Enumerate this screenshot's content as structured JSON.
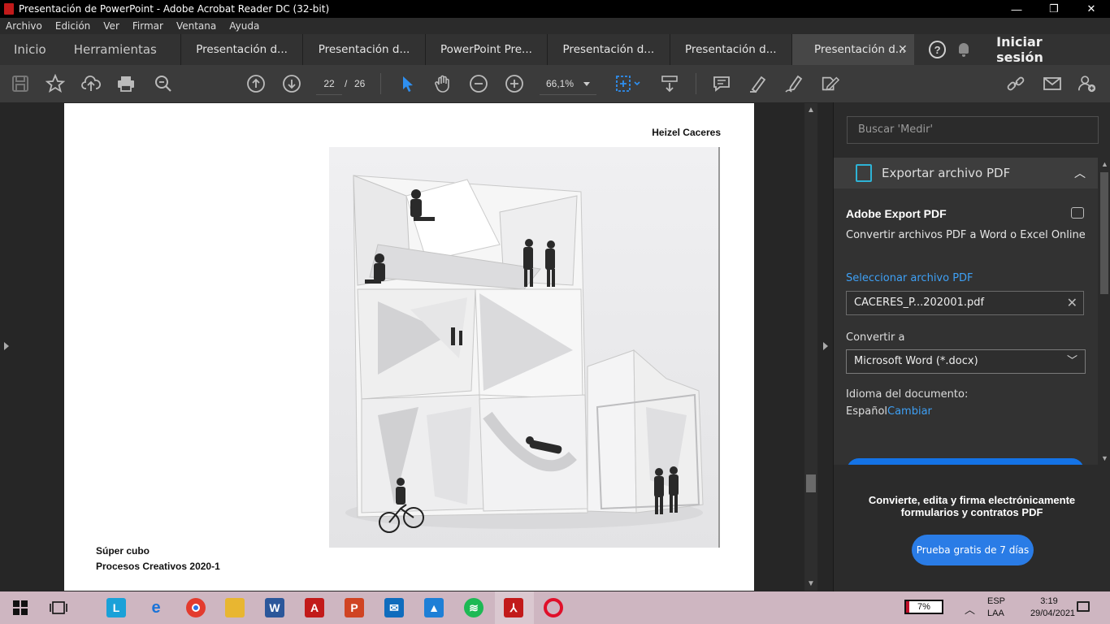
{
  "window": {
    "title": "Presentación de PowerPoint - Adobe Acrobat Reader DC (32-bit)",
    "minimize": "—",
    "maximize": "❐",
    "close": "✕"
  },
  "menu": [
    "Archivo",
    "Edición",
    "Ver",
    "Firmar",
    "Ventana",
    "Ayuda"
  ],
  "tabs": {
    "home": "Inicio",
    "tools": "Herramientas",
    "documents": [
      "Presentación d...",
      "Presentación d...",
      "PowerPoint Pre...",
      "Presentación d...",
      "Presentación d...",
      "Presentación d..."
    ],
    "active_close": "✕",
    "help": "?",
    "sign_in": "Iniciar sesión"
  },
  "toolbar": {
    "current_page": "22",
    "page_separator": "/",
    "total_pages": "26",
    "zoom": "66,1%"
  },
  "document": {
    "author": "Heizel Caceres",
    "caption_title": "Súper cubo",
    "caption_course": "Procesos Creativos 2020-1"
  },
  "right_pane": {
    "search_placeholder": "Buscar 'Medir'",
    "section_title": "Exportar archivo PDF",
    "panel_title": "Adobe Export PDF",
    "panel_subtitle": "Convertir archivos PDF a Word o Excel Online",
    "select_file_link": "Seleccionar archivo PDF",
    "selected_file": "CACERES_P...202001.pdf",
    "convert_to_label": "Convertir a",
    "convert_to_value": "Microsoft Word (*.docx)",
    "language_label": "Idioma del documento:",
    "language_value": "Español",
    "language_change": "Cambiar",
    "promo_text": "Convierte, edita y firma electrónicamente formularios y contratos PDF",
    "promo_button": "Prueba gratis de 7 días"
  },
  "taskbar": {
    "battery": "7%",
    "lang_top": "ESP",
    "lang_bottom": "LAA",
    "time": "3:19",
    "date": "29/04/2021"
  },
  "colors": {
    "accent_blue": "#1473e6",
    "link_blue": "#3ea0f5",
    "taskbar": "#ceb6c1",
    "acrobat_red": "#c21a1a"
  }
}
